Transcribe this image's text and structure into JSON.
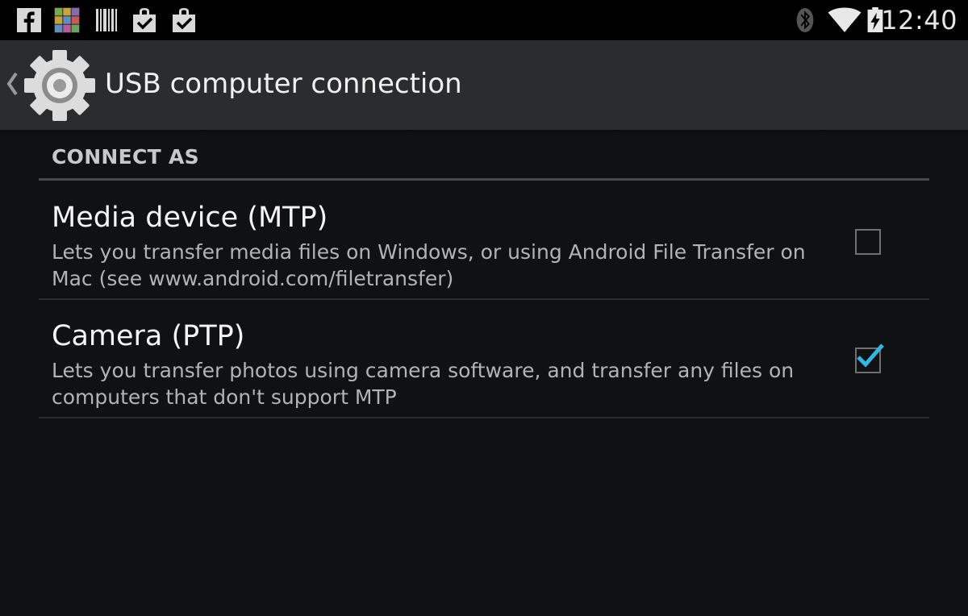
{
  "status_bar": {
    "notification_icons": [
      "facebook-icon",
      "game-app-icon",
      "barcode-icon",
      "download-complete-icon",
      "download-complete-icon"
    ],
    "system_icons": [
      "bluetooth-icon",
      "wifi-icon",
      "battery-charging-icon"
    ],
    "time": "12:40"
  },
  "action_bar": {
    "title": "USB computer connection",
    "icon": "settings-gear-icon"
  },
  "section": {
    "header": "CONNECT AS"
  },
  "options": [
    {
      "title": "Media device (MTP)",
      "summary": "Lets you transfer media files on Windows, or using Android File Transfer on Mac (see www.android.com/filetransfer)",
      "checked": false
    },
    {
      "title": "Camera (PTP)",
      "summary": "Lets you transfer photos using camera software, and transfer any files on computers that don't support MTP",
      "checked": true
    }
  ],
  "colors": {
    "accent": "#33b5e5",
    "background": "#101113",
    "action_bar": "#2b2c2e"
  }
}
